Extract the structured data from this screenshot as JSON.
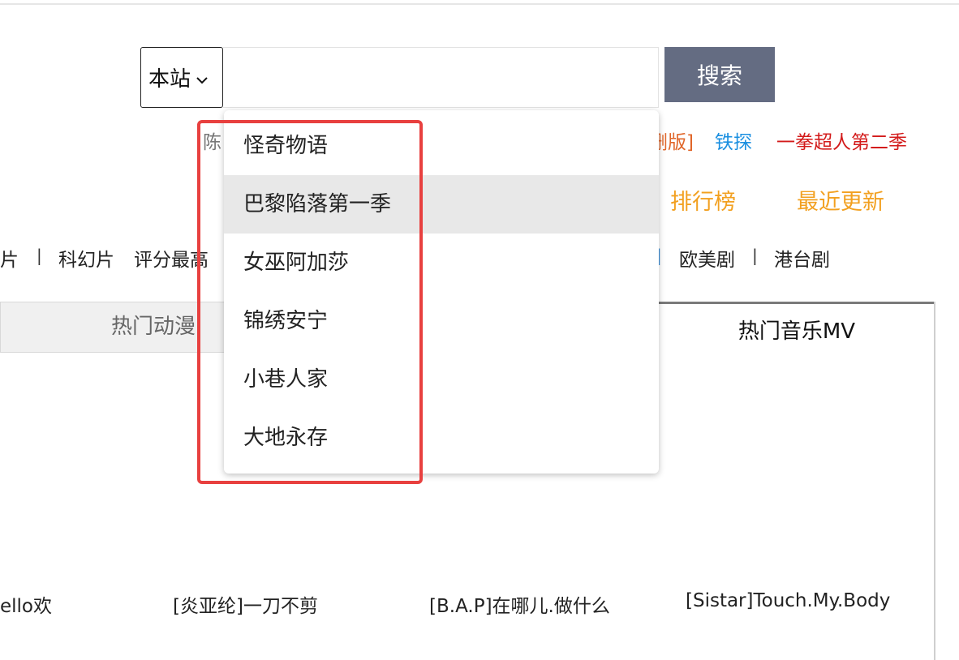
{
  "search": {
    "scope_label": "本站",
    "button_label": "搜索",
    "input_value": ""
  },
  "hot_keywords": [
    {
      "text": "陈"
    },
    {
      "text": "删版]"
    },
    {
      "text": "铁探"
    },
    {
      "text": "一拳超人第二季"
    }
  ],
  "nav": {
    "ranking": "排行榜",
    "latest": "最近更新"
  },
  "categories": {
    "left_partial": "片",
    "sep1": "|",
    "scifi": "科幻片",
    "top_rated": "评分最高",
    "sep_blue": "|",
    "western": "欧美剧",
    "sep2": "|",
    "hk_tw": "港台剧"
  },
  "tabs": {
    "anime": "热门动漫",
    "music_mv": "热门音乐MV"
  },
  "videos": [
    {
      "title": "ello欢"
    },
    {
      "title": "[炎亚纶]一刀不剪"
    },
    {
      "title": "[B.A.P]在哪儿.做什么"
    },
    {
      "title": "[Sistar]Touch.My.Body"
    }
  ],
  "suggestions": [
    {
      "label": "怪奇物语",
      "highlighted": false
    },
    {
      "label": "巴黎陷落第一季",
      "highlighted": true
    },
    {
      "label": "女巫阿加莎",
      "highlighted": false
    },
    {
      "label": "锦绣安宁",
      "highlighted": false
    },
    {
      "label": "小巷人家",
      "highlighted": false
    },
    {
      "label": "大地永存",
      "highlighted": false
    }
  ],
  "colors": {
    "search_button_bg": "#646c82",
    "nav_link": "#f2a020",
    "keyword_red": "#d31b1b",
    "keyword_blue": "#1a8fe0",
    "annotation_box": "#e8403f",
    "suggestion_highlight": "#e8e8e8"
  }
}
